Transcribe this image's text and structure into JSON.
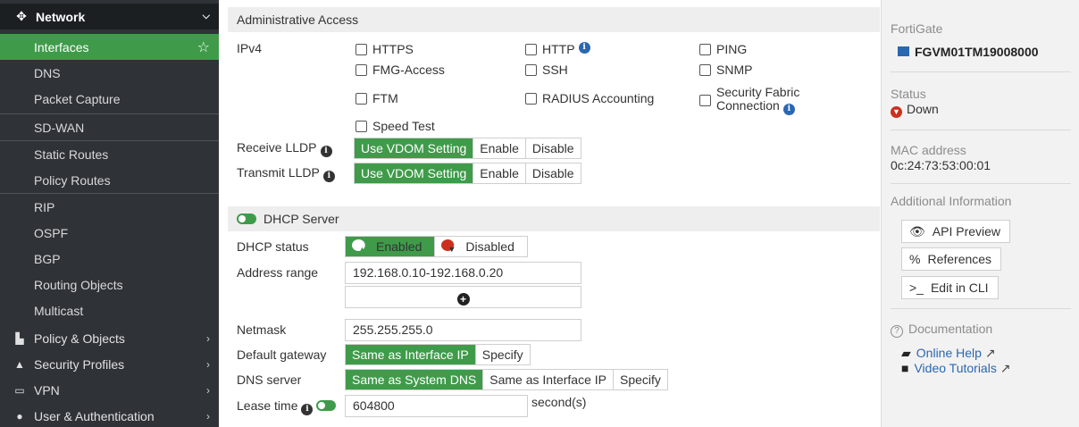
{
  "sidebar": {
    "section_header": {
      "label": "Network",
      "icon": "move-arrows-icon"
    },
    "items": [
      {
        "label": "Interfaces",
        "active": true
      },
      {
        "label": "DNS"
      },
      {
        "label": "Packet Capture"
      },
      {
        "label": "SD-WAN"
      },
      {
        "label": "Static Routes"
      },
      {
        "label": "Policy Routes"
      },
      {
        "label": "RIP"
      },
      {
        "label": "OSPF"
      },
      {
        "label": "BGP"
      },
      {
        "label": "Routing Objects"
      },
      {
        "label": "Multicast"
      }
    ],
    "top_items": [
      {
        "label": "Policy & Objects",
        "icon": "policy-icon"
      },
      {
        "label": "Security Profiles",
        "icon": "lock-icon"
      },
      {
        "label": "VPN",
        "icon": "monitor-icon"
      },
      {
        "label": "User & Authentication",
        "icon": "user-icon"
      }
    ]
  },
  "admin_access": {
    "title": "Administrative Access",
    "ipv4_label": "IPv4",
    "options": [
      "HTTPS",
      "HTTP",
      "PING",
      "FMG-Access",
      "SSH",
      "SNMP",
      "FTM",
      "RADIUS Accounting",
      "Security Fabric",
      "Connection",
      "Speed Test"
    ],
    "receive_lldp_label": "Receive LLDP",
    "transmit_lldp_label": "Transmit LLDP",
    "lldp_options": [
      "Use VDOM Setting",
      "Enable",
      "Disable"
    ]
  },
  "dhcp": {
    "title": "DHCP Server",
    "status_label": "DHCP status",
    "status_enabled": "Enabled",
    "status_disabled": "Disabled",
    "address_range_label": "Address range",
    "address_range_value": "192.168.0.10-192.168.0.20",
    "netmask_label": "Netmask",
    "netmask_value": "255.255.255.0",
    "gateway_label": "Default gateway",
    "gateway_options": [
      "Same as Interface IP",
      "Specify"
    ],
    "dns_label": "DNS server",
    "dns_options": [
      "Same as System DNS",
      "Same as Interface IP",
      "Specify"
    ],
    "lease_label": "Lease time",
    "lease_value": "604800",
    "lease_unit": "second(s)"
  },
  "right_panel": {
    "fortigate_label": "FortiGate",
    "fortigate_value": "FGVM01TM19008000",
    "status_label": "Status",
    "status_value": "Down",
    "mac_label": "MAC address",
    "mac_value": "0c:24:73:53:00:01",
    "additional_label": "Additional Information",
    "buttons": [
      "API Preview",
      "References",
      "Edit in CLI"
    ],
    "doc_label": "Documentation",
    "links": [
      "Online Help",
      "Video Tutorials"
    ]
  },
  "colors": {
    "accent_green": "#3f9b4a",
    "sidebar_bg": "#2f3338",
    "link_blue": "#2a67b1",
    "status_red": "#cc2f1e"
  }
}
